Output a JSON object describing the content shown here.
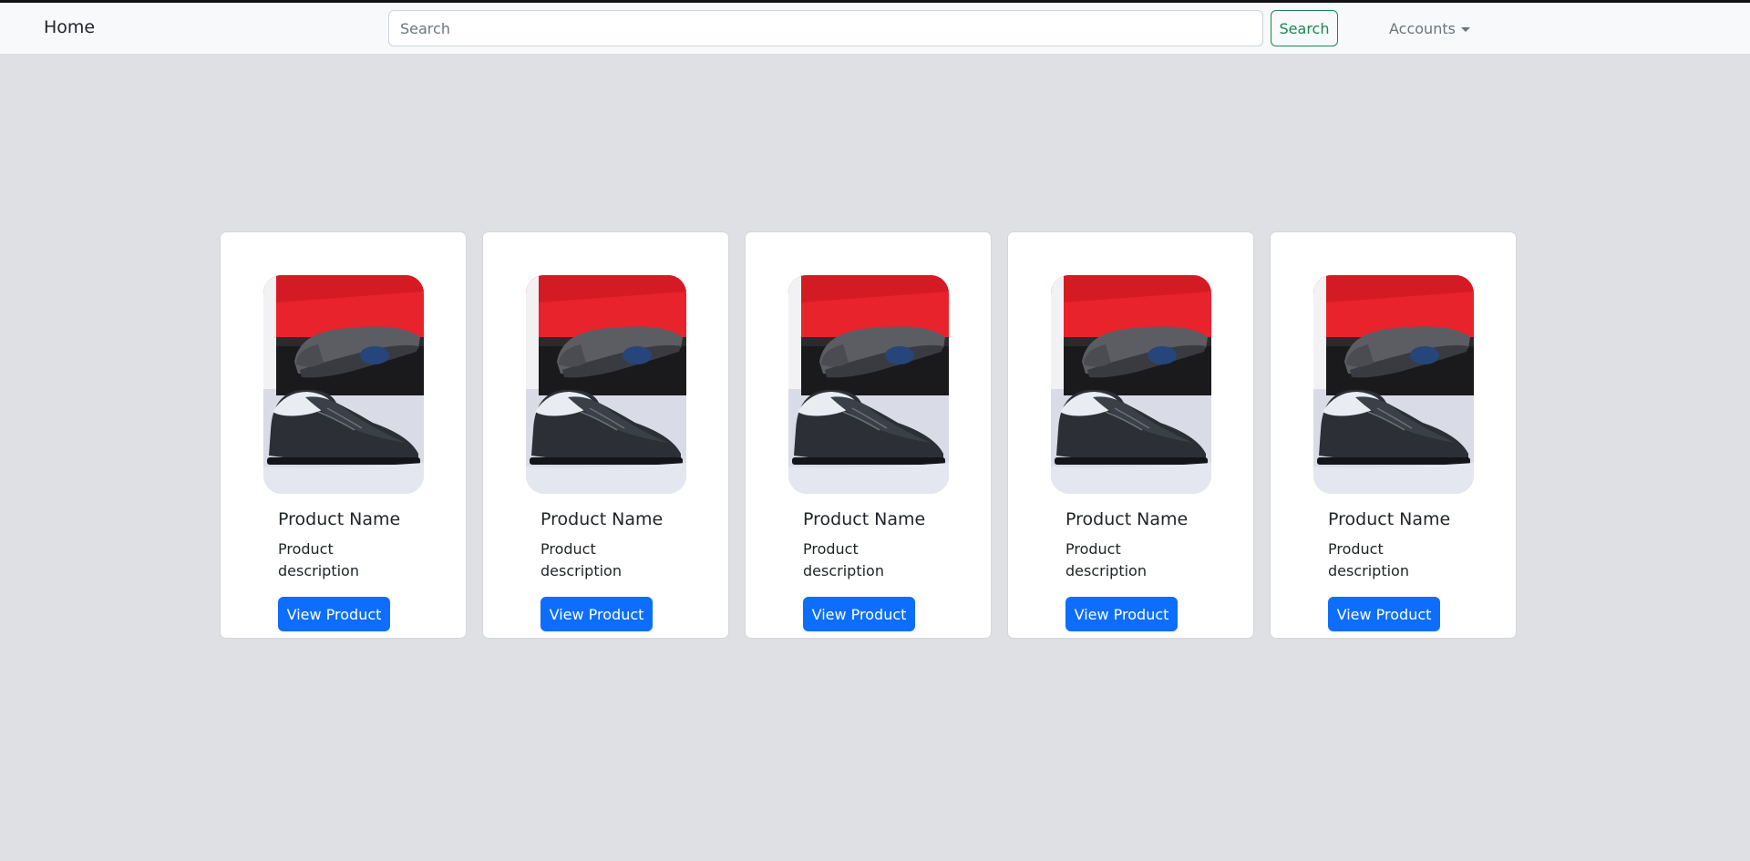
{
  "navbar": {
    "brand": "Home",
    "search_placeholder": "Search",
    "search_button": "Search",
    "accounts_label": "Accounts"
  },
  "products": [
    {
      "name": "Product Name",
      "description": "Product description",
      "button": "View Product",
      "image": "shoes-product-photo"
    },
    {
      "name": "Product Name",
      "description": "Product description",
      "button": "View Product",
      "image": "shoes-product-photo"
    },
    {
      "name": "Product Name",
      "description": "Product description",
      "button": "View Product",
      "image": "shoes-product-photo"
    },
    {
      "name": "Product Name",
      "description": "Product description",
      "button": "View Product",
      "image": "shoes-product-photo"
    },
    {
      "name": "Product Name",
      "description": "Product description",
      "button": "View Product",
      "image": "shoes-product-photo"
    }
  ],
  "colors": {
    "page_background": "#dee0e4",
    "navbar_background": "#f8f9fa",
    "primary_button": "#0d6efd",
    "success_outline": "#198754"
  }
}
